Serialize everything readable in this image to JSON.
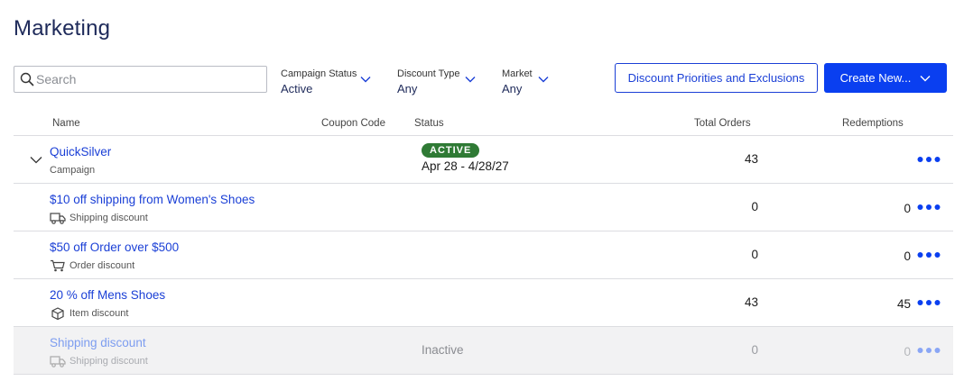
{
  "page": {
    "title": "Marketing"
  },
  "search": {
    "placeholder": "Search",
    "value": ""
  },
  "filters": [
    {
      "label": "Campaign Status",
      "value": "Active"
    },
    {
      "label": "Discount Type",
      "value": "Any"
    },
    {
      "label": "Market",
      "value": "Any"
    }
  ],
  "actions": {
    "priorities_label": "Discount Priorities and Exclusions",
    "create_label": "Create New..."
  },
  "columns": {
    "name": "Name",
    "coupon_code": "Coupon Code",
    "status": "Status",
    "total_orders": "Total Orders",
    "redemptions": "Redemptions"
  },
  "campaign": {
    "name": "QuickSilver",
    "type": "Campaign",
    "status_badge": "ACTIVE",
    "date_range": "Apr 28 - 4/28/27",
    "total_orders": "43",
    "redemptions": ""
  },
  "discounts": [
    {
      "name": "$10 off shipping from Women's Shoes",
      "type": "Shipping discount",
      "icon": "truck-icon",
      "status": "",
      "total_orders": "0",
      "redemptions": "0",
      "inactive": false
    },
    {
      "name": "$50 off Order over $500",
      "type": "Order discount",
      "icon": "cart-icon",
      "status": "",
      "total_orders": "0",
      "redemptions": "0",
      "inactive": false
    },
    {
      "name": "20 % off Mens Shoes",
      "type": "Item discount",
      "icon": "box-icon",
      "status": "",
      "total_orders": "43",
      "redemptions": "45",
      "inactive": false
    },
    {
      "name": "Shipping discount",
      "type": "Shipping discount",
      "icon": "truck-icon",
      "status": "Inactive",
      "total_orders": "0",
      "redemptions": "0",
      "inactive": true
    }
  ],
  "colors": {
    "accent": "#0a3ff0",
    "link": "#1a3fd6",
    "active_badge": "#2f7a35",
    "title": "#1e2a5a"
  }
}
